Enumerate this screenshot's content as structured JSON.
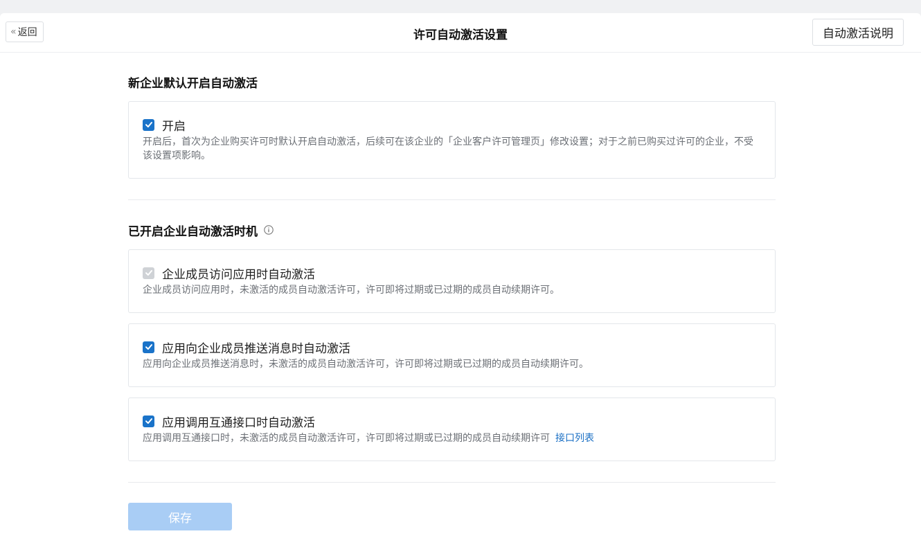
{
  "header": {
    "back_label": "返回",
    "title": "许可自动激活设置",
    "help_label": "自动激活说明"
  },
  "section1": {
    "title": "新企业默认开启自动激活",
    "option": {
      "label": "开启",
      "checked": true,
      "desc": "开启后，首次为企业购买许可时默认开启自动激活，后续可在该企业的「企业客户许可管理页」修改设置；对于之前已购买过许可的企业，不受该设置项影响。"
    }
  },
  "section2": {
    "title": "已开启企业自动激活时机",
    "options": [
      {
        "label": "企业成员访问应用时自动激活",
        "checked": true,
        "disabled": true,
        "desc": "企业成员访问应用时，未激活的成员自动激活许可，许可即将过期或已过期的成员自动续期许可。"
      },
      {
        "label": "应用向企业成员推送消息时自动激活",
        "checked": true,
        "disabled": false,
        "desc": "应用向企业成员推送消息时，未激活的成员自动激活许可，许可即将过期或已过期的成员自动续期许可。"
      },
      {
        "label": "应用调用互通接口时自动激活",
        "checked": true,
        "disabled": false,
        "desc": "应用调用互通接口时，未激活的成员自动激活许可，许可即将过期或已过期的成员自动续期许可",
        "link": "接口列表"
      }
    ]
  },
  "footer": {
    "save_label": "保存"
  },
  "colors": {
    "accent": "#1a73c9",
    "save_disabled": "#a9cdf5",
    "link": "#1a6fc4"
  }
}
